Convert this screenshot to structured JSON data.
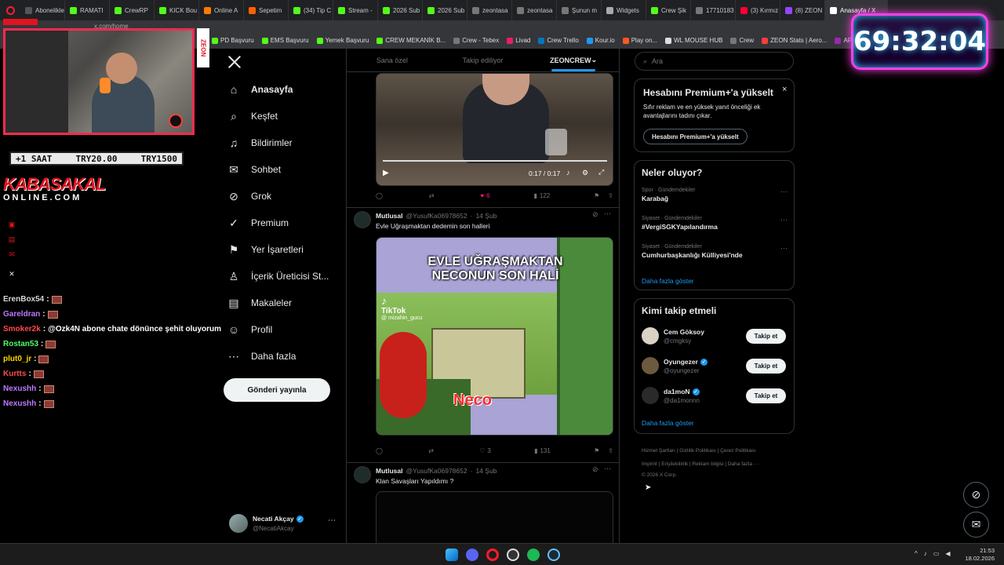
{
  "browser": {
    "tabs": [
      {
        "label": "Abonelikle",
        "color": "#555"
      },
      {
        "label": "RAMATI",
        "color": "#53fc18"
      },
      {
        "label": "CrewRP",
        "color": "#53fc18"
      },
      {
        "label": "KICK Bou",
        "color": "#53fc18"
      },
      {
        "label": "Online A",
        "color": "#ff7a00"
      },
      {
        "label": "Sepetim",
        "color": "#ff6000"
      },
      {
        "label": "(34) Tip C",
        "color": "#53fc18"
      },
      {
        "label": "Stream -",
        "color": "#53fc18"
      },
      {
        "label": "2026 Sub",
        "color": "#53fc18"
      },
      {
        "label": "2026 Sub",
        "color": "#53fc18"
      },
      {
        "label": "zeontasa",
        "color": "#777"
      },
      {
        "label": "zeontasa",
        "color": "#777"
      },
      {
        "label": "Şunun m",
        "color": "#777"
      },
      {
        "label": "Widgets",
        "color": "#aaa"
      },
      {
        "label": "Crew Şik",
        "color": "#53fc18"
      },
      {
        "label": "17710183",
        "color": "#777"
      },
      {
        "label": "(3) Kırmız",
        "color": "#ff0033"
      },
      {
        "label": "(8) ZEON",
        "color": "#9146ff"
      },
      {
        "label": "Anasayfa / X",
        "color": "#fff",
        "active": true
      }
    ],
    "address": "x.com/home",
    "bookmarks": [
      {
        "label": "PD Başvuru",
        "color": "#53fc18"
      },
      {
        "label": "EMS Başvuru",
        "color": "#53fc18"
      },
      {
        "label": "Yemek Başvuru",
        "color": "#53fc18"
      },
      {
        "label": "CREW MEKANİK B...",
        "color": "#53fc18"
      },
      {
        "label": "Crew - Tebex",
        "color": "#777"
      },
      {
        "label": "Livad",
        "color": "#e91e63"
      },
      {
        "label": "Crew Trello",
        "color": "#0079bf"
      },
      {
        "label": "Kour.io",
        "color": "#2196f3"
      },
      {
        "label": "Play on...",
        "color": "#ff5722"
      },
      {
        "label": "WL MOUSE HUB",
        "color": "#ddd"
      },
      {
        "label": "Crew",
        "color": "#777"
      },
      {
        "label": "ZEON Stats | Aero...",
        "color": "#ff3d3d"
      },
      {
        "label": "APIq",
        "color": "#9c27b0"
      }
    ]
  },
  "nav": {
    "items": [
      {
        "label": "Anasayfa",
        "icon": "home-icon",
        "glyph": "⌂",
        "active": true
      },
      {
        "label": "Keşfet",
        "icon": "search-icon",
        "glyph": "⌕"
      },
      {
        "label": "Bildirimler",
        "icon": "bell-icon",
        "glyph": "♫"
      },
      {
        "label": "Sohbet",
        "icon": "mail-icon",
        "glyph": "✉"
      },
      {
        "label": "Grok",
        "icon": "grok-icon",
        "glyph": "⊘"
      },
      {
        "label": "Premium",
        "icon": "premium-icon",
        "glyph": "✓"
      },
      {
        "label": "Yer İşaretleri",
        "icon": "bookmark-icon",
        "glyph": "⚑"
      },
      {
        "label": "İçerik Üreticisi St...",
        "icon": "creator-studio-icon",
        "glyph": "♙"
      },
      {
        "label": "Makaleler",
        "icon": "articles-icon",
        "glyph": "▤"
      },
      {
        "label": "Profil",
        "icon": "profile-icon",
        "glyph": "☺"
      },
      {
        "label": "Daha fazla",
        "icon": "more-icon",
        "glyph": "⋯"
      }
    ],
    "post_button": "Gönderi yayınla",
    "account": {
      "name": "Necati Akçay",
      "handle": "@NecatiAkcay"
    }
  },
  "feed": {
    "tabs": [
      {
        "label": "Sana özel"
      },
      {
        "label": "Takip ediliyor"
      },
      {
        "label": "ZEONCREW",
        "active": true
      }
    ],
    "video1": {
      "time": "0:17 / 0:17"
    },
    "tweet1_actions": {
      "replies": "",
      "retweets": "",
      "likes": "6",
      "views": "122"
    },
    "tweet2": {
      "name": "Mutlusal",
      "handle": "@YusufKa06978652",
      "date": "14 Şub",
      "text": "Evle Uğraşmaktan dedemin son halleri",
      "caption_line1": "EVLE UĞRAŞMAKTAN",
      "caption_line2": "NECONUN SON HALİ",
      "tiktok": "TikTok",
      "tiktok_user": "@ mizahin_gucu",
      "neco": "Neco",
      "actions": {
        "replies": "",
        "retweets": "",
        "likes": "3",
        "views": "131"
      }
    },
    "tweet3": {
      "name": "Mutlusal",
      "handle": "@YusufKa06978652",
      "date": "14 Şub",
      "text": "Klan Savaşları Yapıldımı ?"
    }
  },
  "right": {
    "search_placeholder": "Ara",
    "premium": {
      "title": "Hesabını Premium+'a yükselt",
      "body": "Sıfır reklam ve en yüksek yanıt önceliği ek avantajlarını tadını çıkar.",
      "button": "Hesabını Premium+'a yükselt"
    },
    "trends": {
      "title": "Neler oluyor?",
      "items": [
        {
          "meta": "Spor · Gündemdekiler",
          "name": "Karabağ"
        },
        {
          "meta": "Siyaset · Gündemdekiler",
          "name": "#VergiSGKYapılandırma"
        },
        {
          "meta": "Siyaset · Gündemdekiler",
          "name": "Cumhurbaşkanlığı Külliyesi'nde"
        }
      ],
      "show_more": "Daha fazla göster"
    },
    "who_to_follow": {
      "title": "Kimi takip etmeli",
      "items": [
        {
          "name": "Cem Göksoy",
          "handle": "@cmgksy",
          "verified": false,
          "color": "#d9d2c5"
        },
        {
          "name": "Oyungezer",
          "handle": "@oyungezer",
          "verified": true,
          "color": "#6b5a3e"
        },
        {
          "name": "da1moN",
          "handle": "@da1monnn",
          "verified": true,
          "color": "#2a2a2a"
        }
      ],
      "follow_label": "Takip et",
      "show_more": "Daha fazla göster"
    },
    "footer": {
      "line1": [
        "Hizmet Şartları",
        "Gizlilik Politikası",
        "Çerez Politikası"
      ],
      "line2": [
        "Imprint",
        "Erişilebilirlik",
        "Reklam bilgisi",
        "Daha fazla ···"
      ],
      "copyright": "© 2026 X Corp."
    }
  },
  "stream": {
    "sub_bar": {
      "left": "+1 SAAT",
      "mid": "TRY20.00",
      "right": "TRY1500"
    },
    "brand_top": "KABASAKAL",
    "brand_bottom": "ONLINE.COM",
    "side_logo": "ZEON",
    "timer": "69:32:04",
    "chat": [
      {
        "user": "ErenBox54",
        "color": "#d7d7d7",
        "msg": ""
      },
      {
        "user": "Gareldran",
        "color": "#b97bff",
        "msg": ""
      },
      {
        "user": "Smoker2k",
        "color": "#ff4b4b",
        "msg": "@Ozk4N abone chate dönünce şehit oluyorum"
      },
      {
        "user": "Rostan53",
        "color": "#4bff6a",
        "msg": ""
      },
      {
        "user": "plut0_jr",
        "color": "#ffd400",
        "msg": ""
      },
      {
        "user": "Kurtts",
        "color": "#ff4b4b",
        "msg": ""
      },
      {
        "user": "Nexushh",
        "color": "#b97bff",
        "msg": ""
      },
      {
        "user": "Nexushh",
        "color": "#b97bff",
        "msg": ""
      }
    ]
  },
  "taskbar": {
    "time": "21:53",
    "date": "18.02.2026"
  }
}
